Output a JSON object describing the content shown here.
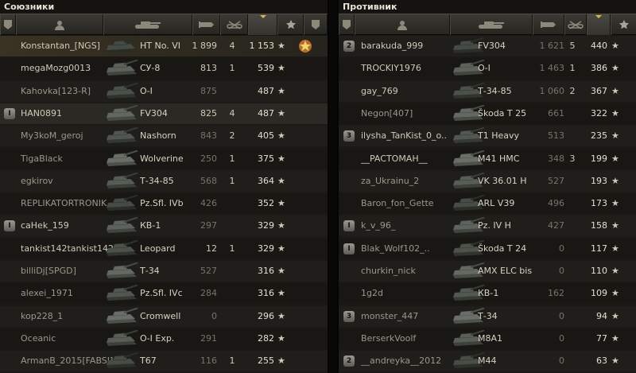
{
  "allies": {
    "title": "Союзники",
    "rows": [
      {
        "name": "Konstantan_[NGS]",
        "tank": "HT No. VI",
        "damage": "1 899",
        "kills": "4",
        "exp": "1 153",
        "platoon": "",
        "medal": true
      },
      {
        "name": "megaMozg0013",
        "tank": "СУ-8",
        "damage": "813",
        "kills": "1",
        "exp": "539",
        "platoon": ""
      },
      {
        "name": "Kahovka[123-R]",
        "tank": "О-I",
        "damage": "875",
        "kills": "",
        "exp": "487",
        "platoon": ""
      },
      {
        "name": "HAN0891",
        "tank": "FV304",
        "damage": "825",
        "kills": "4",
        "exp": "487",
        "platoon": "I"
      },
      {
        "name": "My3koM_geroj",
        "tank": "Nashorn",
        "damage": "843",
        "kills": "2",
        "exp": "405",
        "platoon": ""
      },
      {
        "name": "TigaBlack",
        "tank": "Wolverine",
        "damage": "250",
        "kills": "1",
        "exp": "375",
        "platoon": ""
      },
      {
        "name": "egkirov",
        "tank": "Т-34-85",
        "damage": "568",
        "kills": "1",
        "exp": "364",
        "platoon": ""
      },
      {
        "name": "REPLIKATORTRONIK..",
        "tank": "Pz.Sfl. IVb",
        "damage": "426",
        "kills": "",
        "exp": "352",
        "platoon": ""
      },
      {
        "name": "caHek_159",
        "tank": "КВ-1",
        "damage": "297",
        "kills": "",
        "exp": "329",
        "platoon": "I"
      },
      {
        "name": "tankist142tankist142",
        "tank": "Leopard",
        "damage": "12",
        "kills": "1",
        "exp": "329",
        "platoon": ""
      },
      {
        "name": "billiDj[SPGD]",
        "tank": "Т-34",
        "damage": "527",
        "kills": "",
        "exp": "316",
        "platoon": ""
      },
      {
        "name": "alexei_1971",
        "tank": "Pz.Sfl. IVc",
        "damage": "284",
        "kills": "",
        "exp": "316",
        "platoon": ""
      },
      {
        "name": "kop228_1",
        "tank": "Cromwell",
        "damage": "0",
        "kills": "",
        "exp": "296",
        "platoon": ""
      },
      {
        "name": "Oceanic",
        "tank": "О-I Exp.",
        "damage": "291",
        "kills": "",
        "exp": "282",
        "platoon": ""
      },
      {
        "name": "ArmanB_2015[FABSI]",
        "tank": "T67",
        "damage": "116",
        "kills": "1",
        "exp": "255",
        "platoon": ""
      }
    ]
  },
  "enemies": {
    "title": "Противник",
    "rows": [
      {
        "name": "barakuda_999",
        "tank": "FV304",
        "damage": "1 621",
        "kills": "5",
        "exp": "440",
        "platoon": "2"
      },
      {
        "name": "TROCKIY1976",
        "tank": "О-I",
        "damage": "1 463",
        "kills": "1",
        "exp": "386",
        "platoon": ""
      },
      {
        "name": "gay_769",
        "tank": "Т-34-85",
        "damage": "1 060",
        "kills": "2",
        "exp": "367",
        "platoon": ""
      },
      {
        "name": "Negon[407]",
        "tank": "Škoda T 25",
        "damage": "661",
        "kills": "",
        "exp": "322",
        "platoon": ""
      },
      {
        "name": "ilysha_TanKist_0_o..",
        "tank": "T1 Heavy",
        "damage": "513",
        "kills": "",
        "exp": "235",
        "platoon": "3"
      },
      {
        "name": "__PACTOMAH__",
        "tank": "M41 HMC",
        "damage": "348",
        "kills": "3",
        "exp": "199",
        "platoon": ""
      },
      {
        "name": "za_Ukrainu_2",
        "tank": "VK 36.01 H",
        "damage": "527",
        "kills": "",
        "exp": "193",
        "platoon": ""
      },
      {
        "name": "Baron_fon_Gette",
        "tank": "ARL V39",
        "damage": "496",
        "kills": "",
        "exp": "173",
        "platoon": ""
      },
      {
        "name": "k_v_96_",
        "tank": "Pz. IV H",
        "damage": "427",
        "kills": "",
        "exp": "158",
        "platoon": "I"
      },
      {
        "name": "Blak_Wolf102_..",
        "tank": "Škoda T 24",
        "damage": "0",
        "kills": "",
        "exp": "117",
        "platoon": "I"
      },
      {
        "name": "churkin_nick",
        "tank": "AMX ELC bis",
        "damage": "0",
        "kills": "",
        "exp": "110",
        "platoon": ""
      },
      {
        "name": "1g2d",
        "tank": "КВ-1",
        "damage": "162",
        "kills": "",
        "exp": "109",
        "platoon": ""
      },
      {
        "name": "monster_447",
        "tank": "Т-34",
        "damage": "0",
        "kills": "",
        "exp": "94",
        "platoon": "3"
      },
      {
        "name": "BerserkVoolf",
        "tank": "M8A1",
        "damage": "0",
        "kills": "",
        "exp": "77",
        "platoon": ""
      },
      {
        "name": "__andreyka__2012",
        "tank": "M44",
        "damage": "0",
        "kills": "",
        "exp": "63",
        "platoon": "2"
      }
    ]
  },
  "colors": {
    "accent": "#d7b844",
    "row_highlight": "#3a3222"
  },
  "icons": {
    "squad": "squad-icon",
    "player": "player-icon",
    "tank": "tank-icon",
    "damage": "shell-icon",
    "kills": "kills-icon",
    "exp": "star-icon",
    "medal": "medal-icon"
  }
}
